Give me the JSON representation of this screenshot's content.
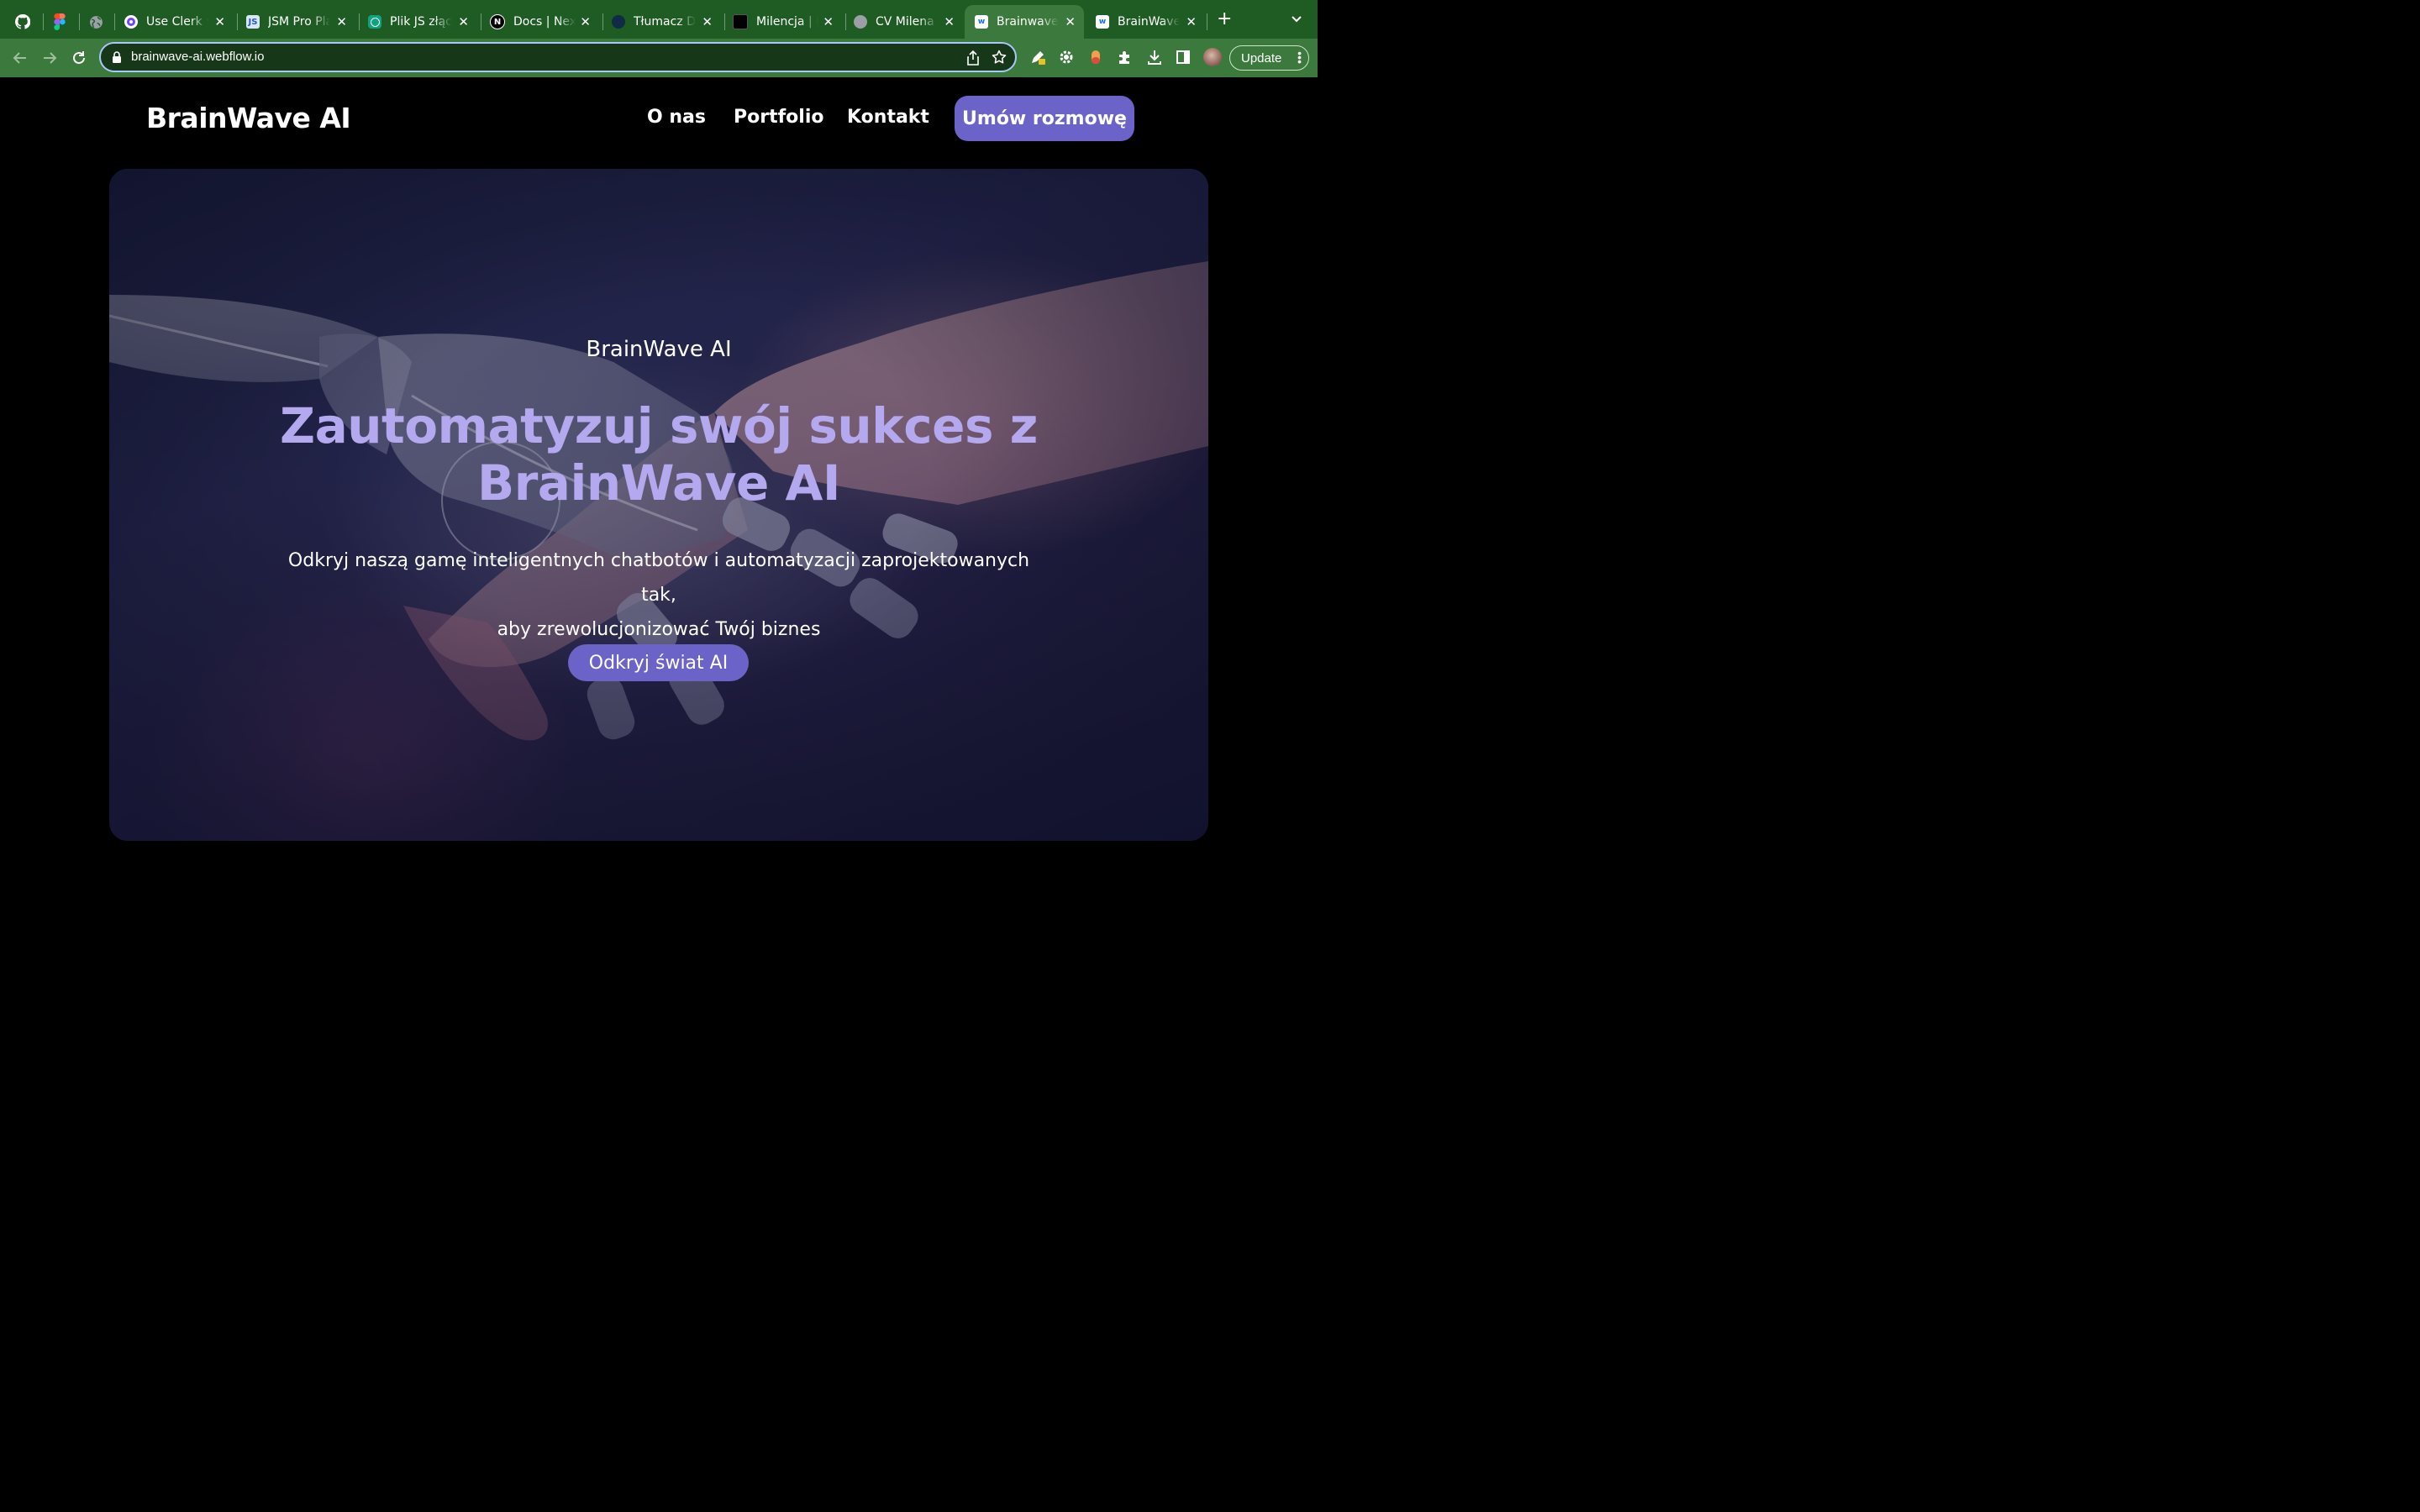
{
  "browser": {
    "tabs": [
      {
        "title": "",
        "favicon": "github-icon"
      },
      {
        "title": "",
        "favicon": "figma-icon"
      },
      {
        "title": "",
        "favicon": "globe-icon"
      },
      {
        "title": "Use Clerk w",
        "favicon": "clerk-icon"
      },
      {
        "title": "JSM Pro Pla",
        "favicon": "jsm-icon"
      },
      {
        "title": "Plik JS złąc",
        "favicon": "chatgpt-icon"
      },
      {
        "title": "Docs | Next",
        "favicon": "nextjs-icon"
      },
      {
        "title": "Tłumacz De",
        "favicon": "deepl-icon"
      },
      {
        "title": "Milencja | P",
        "favicon": "milencja-icon"
      },
      {
        "title": "CV Milena I",
        "favicon": "globe-icon"
      },
      {
        "title": "Brainwave A",
        "favicon": "webflow-icon",
        "active": true
      },
      {
        "title": "BrainWave",
        "favicon": "webflow-icon"
      }
    ],
    "url": "brainwave-ai.webflow.io",
    "update_label": "Update",
    "colors": {
      "frame": "#1e5c24",
      "toolbar": "#3b7a3c",
      "omnibox": "#163818",
      "focus_ring": "#a8c7fa"
    }
  },
  "site": {
    "logo": "BrainWave AI",
    "nav": {
      "about": "O nas",
      "portfolio": "Portfolio",
      "contact": "Kontakt",
      "cta": "Umów rozmowę"
    },
    "hero": {
      "eyebrow": "BrainWave AI",
      "title_line1": "Zautomatyzuj swój sukces z",
      "title_line2": "BrainWave AI",
      "subtitle_line1": "Odkryj naszą gamę inteligentnych chatbotów i automatyzacji zaprojektowanych tak,",
      "subtitle_line2": "aby zrewolucjonizować Twój biznes",
      "cta": "Odkryj świat AI"
    },
    "colors": {
      "accent": "#6b63c8",
      "title": "#b4a8ee",
      "background": "#000000"
    }
  }
}
